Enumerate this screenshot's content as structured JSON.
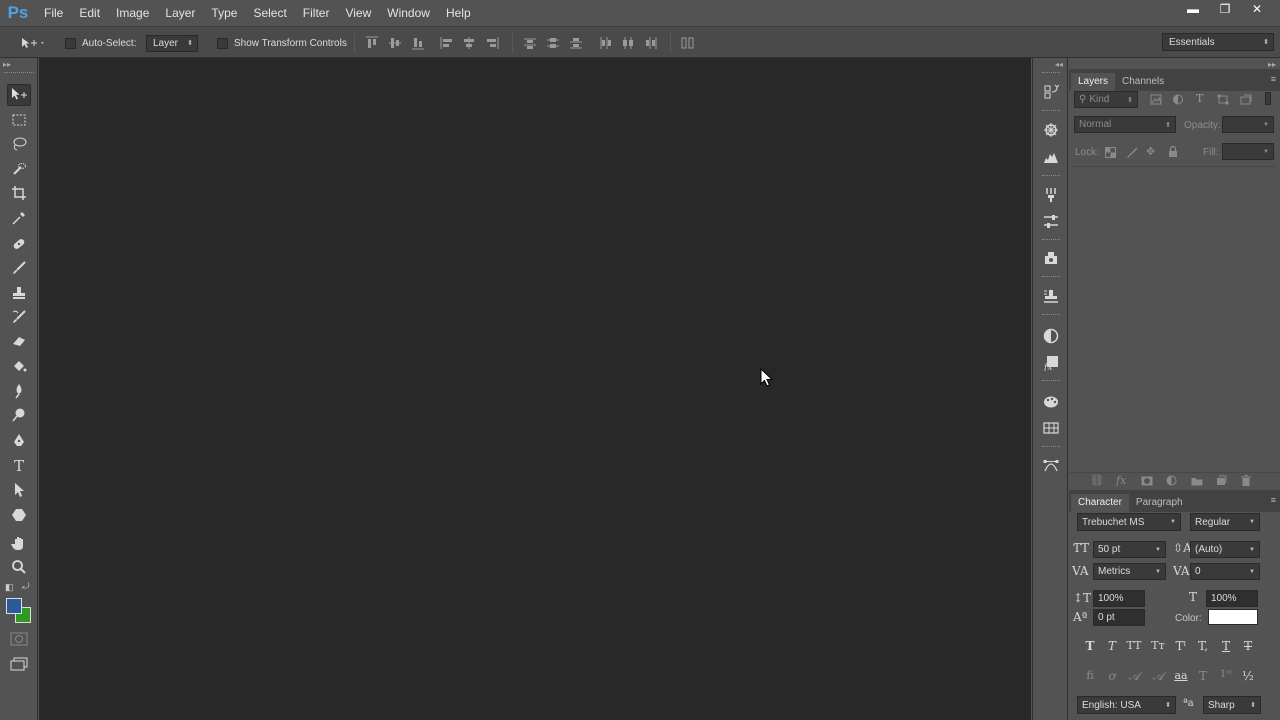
{
  "app": {
    "logo": "Ps"
  },
  "menu": [
    "File",
    "Edit",
    "Image",
    "Layer",
    "Type",
    "Select",
    "Filter",
    "View",
    "Window",
    "Help"
  ],
  "window_controls": {
    "minimize": "▬",
    "restore": "❐",
    "close": "✕"
  },
  "options_bar": {
    "auto_select_label": "Auto-Select:",
    "auto_select_value": "Layer",
    "show_transform_label": "Show Transform Controls",
    "workspace": "Essentials"
  },
  "layers_panel": {
    "tabs": [
      "Layers",
      "Channels"
    ],
    "kind_filter": "Kind",
    "blend_mode": "Normal",
    "opacity_label": "Opacity:",
    "opacity_value": "",
    "lock_label": "Lock:",
    "fill_label": "Fill:",
    "fill_value": ""
  },
  "character_panel": {
    "tabs": [
      "Character",
      "Paragraph"
    ],
    "font_family": "Trebuchet MS",
    "font_style": "Regular",
    "font_size": "50 pt",
    "leading": "(Auto)",
    "kerning": "Metrics",
    "tracking": "0",
    "vertical_scale": "100%",
    "horizontal_scale": "100%",
    "baseline_shift": "0 pt",
    "color_label": "Color:",
    "text_color": "#ffffff",
    "language": "English: USA",
    "antialias": "Sharp"
  },
  "colors": {
    "foreground": "#2a5a9a",
    "background": "#2e9a22",
    "canvas": "#282828"
  },
  "cursor": "arrow-cursor"
}
